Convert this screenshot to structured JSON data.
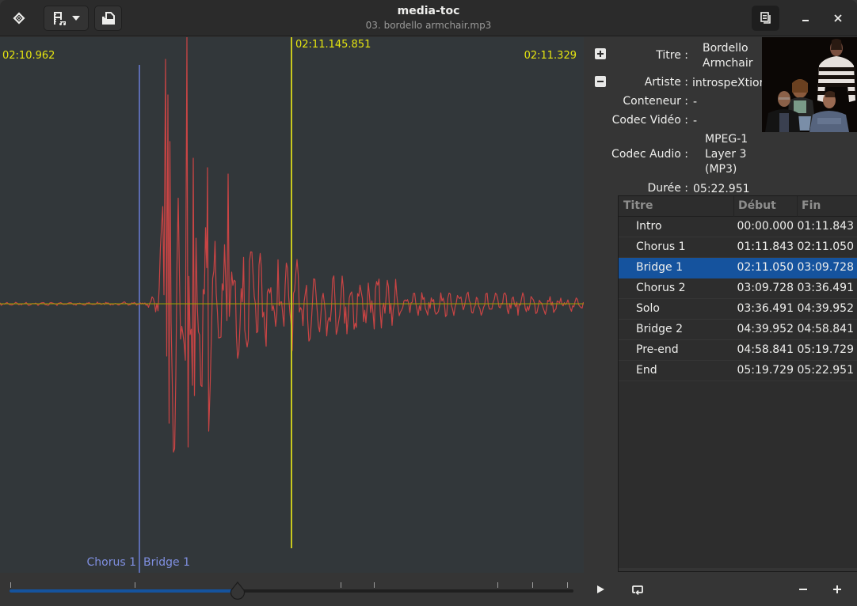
{
  "window": {
    "title": "media-toc",
    "subtitle": "03. bordello armchair.mp3"
  },
  "headerbar": {
    "left_buttons": [
      {
        "name": "app-menu",
        "icon": "diamond-compass-icon"
      },
      {
        "name": "media-menu",
        "icon": "film-music-icon",
        "has_dropdown": true
      },
      {
        "name": "export",
        "icon": "export-icon"
      }
    ],
    "right_buttons": [
      {
        "name": "toggle-info",
        "icon": "document-copy-icon",
        "active": true
      },
      {
        "name": "minimize",
        "icon": "minimize-icon"
      },
      {
        "name": "close",
        "icon": "close-icon"
      }
    ]
  },
  "waveform": {
    "start_time": "02:10.962",
    "cursor_time": "02:11.145.851",
    "end_time": "02:11.329",
    "chapter_boundary": {
      "previous": "Chorus 1",
      "next": "Bridge 1",
      "time": "02:11.050"
    },
    "colors": {
      "background": "#32373a",
      "wave": "#d24545",
      "cursor": "#c8c81e",
      "baseline": "#a0a000",
      "chapter_line": "#6b7fd7",
      "timestamp": "#e5e510"
    }
  },
  "playback": {
    "position_fraction": 0.405,
    "play_icon": "play-icon",
    "loop_icon": "repeat-icon",
    "zoom_out_icon": "minus-icon",
    "zoom_in_icon": "plus-icon"
  },
  "info": {
    "side_buttons": [
      {
        "name": "add-chapter",
        "icon": "plus-square-icon"
      },
      {
        "name": "remove-chapter",
        "icon": "minus-square-icon"
      }
    ],
    "fields": [
      {
        "label": "Titre :",
        "value": "Bordello\nArmchair",
        "lines": [
          "Bordello",
          "Armchair"
        ]
      },
      {
        "label": "Artiste :",
        "value": "introspeXtion"
      },
      {
        "label": "Conteneur :",
        "value": "-"
      },
      {
        "label": "Codec Vidéo :",
        "value": "-"
      },
      {
        "label": "Codec Audio :",
        "value": "MPEG-1 Layer 3 (MP3)",
        "lines": [
          "MPEG-1",
          "Layer 3",
          "(MP3)"
        ]
      },
      {
        "label": "Durée :",
        "value": "05:22.951"
      }
    ],
    "cover_art": "album-cover-image"
  },
  "toc": {
    "columns": [
      "Titre",
      "Début",
      "Fin"
    ],
    "selected_index": 2,
    "rows": [
      {
        "title": "Intro",
        "start": "00:00.000",
        "end": "01:11.843"
      },
      {
        "title": "Chorus 1",
        "start": "01:11.843",
        "end": "02:11.050"
      },
      {
        "title": "Bridge 1",
        "start": "02:11.050",
        "end": "03:09.728"
      },
      {
        "title": "Chorus 2",
        "start": "03:09.728",
        "end": "03:36.491"
      },
      {
        "title": "Solo",
        "start": "03:36.491",
        "end": "04:39.952"
      },
      {
        "title": "Bridge 2",
        "start": "04:39.952",
        "end": "04:58.841"
      },
      {
        "title": "Pre-end",
        "start": "04:58.841",
        "end": "05:19.729"
      },
      {
        "title": "End",
        "start": "05:19.729",
        "end": "05:22.951"
      }
    ]
  }
}
